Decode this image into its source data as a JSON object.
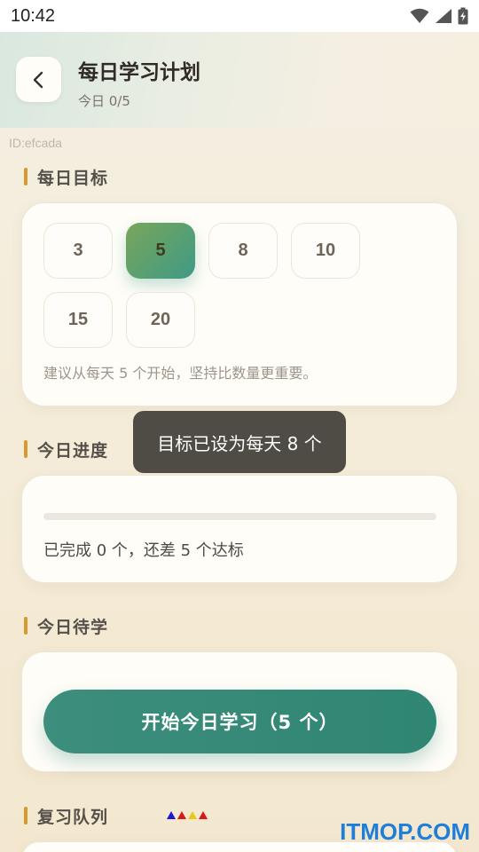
{
  "status_bar": {
    "time": "10:42",
    "icons": [
      "wifi-icon",
      "signal-icon",
      "battery-charging-icon"
    ]
  },
  "header": {
    "back_icon": "chevron-left-icon",
    "title": "每日学习计划",
    "subtitle": "今日 0/5"
  },
  "id_label": "ID:efcada",
  "daily_goal": {
    "heading": "每日目标",
    "options": [
      "3",
      "5",
      "8",
      "10",
      "15",
      "20"
    ],
    "selected": "5",
    "hint": "建议从每天 5 个开始，坚持比数量更重要。"
  },
  "today_progress": {
    "heading": "今日进度",
    "progress_fraction": 0,
    "text": "已完成 0 个，还差 5 个达标"
  },
  "today_pending": {
    "heading": "今日待学",
    "start_button": "开始今日学习（5 个）"
  },
  "review_queue": {
    "heading": "复习队列"
  },
  "toast": "目标已设为每天 8 个",
  "watermark": "ITMOP.COM",
  "colors": {
    "accent_green": "#3f8e7d",
    "section_bar": "#d69a2e",
    "watermark_blue": "#1f7fd6"
  }
}
